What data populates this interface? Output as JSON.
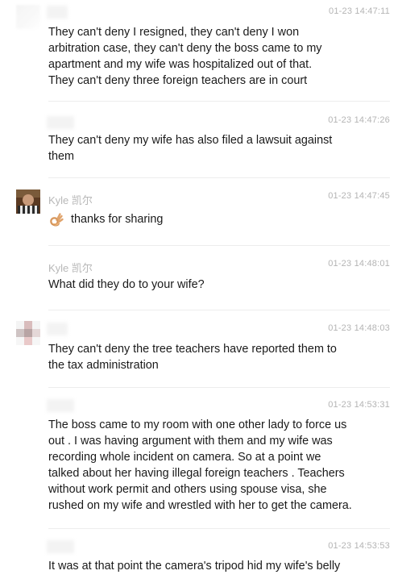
{
  "messages": [
    {
      "name": "",
      "time": "01-23 14:47:11",
      "lines": [
        "They can't deny I resigned, they can't deny I won",
        "arbitration case, they can't deny the boss came to my",
        "apartment and my wife was hospitalized out of that.",
        "They can't deny three foreign teachers are in court"
      ]
    },
    {
      "name": "",
      "time": "01-23 14:47:26",
      "lines": [
        "They can't deny my wife has also filed a lawsuit against",
        "them"
      ]
    },
    {
      "name": "Kyle 凯尔",
      "time": "01-23 14:47:45",
      "emoji": "ok-hand-emoji",
      "lines": [
        "thanks for sharing"
      ]
    },
    {
      "name": "Kyle 凯尔",
      "time": "01-23 14:48:01",
      "lines": [
        "What did they do to your wife?"
      ]
    },
    {
      "name": "",
      "time": "01-23 14:48:03",
      "lines": [
        "They can't deny the tree teachers have reported them to",
        "the tax administration"
      ]
    },
    {
      "name": "",
      "time": "01-23 14:53:31",
      "lines": [
        "The boss came to my room with one other lady to force us",
        "out . I was having argument with them and my wife was",
        "recording whole incident on camera. So at a point we",
        "talked about her having illegal foreign teachers . Teachers",
        "without work permit and others using spouse visa, she",
        "rushed on my wife and wrestled with her to get the camera."
      ]
    },
    {
      "name": "",
      "time": "01-23 14:53:53",
      "lines": [
        "It was at that point the camera's tripod hid my wife's belly"
      ]
    }
  ]
}
